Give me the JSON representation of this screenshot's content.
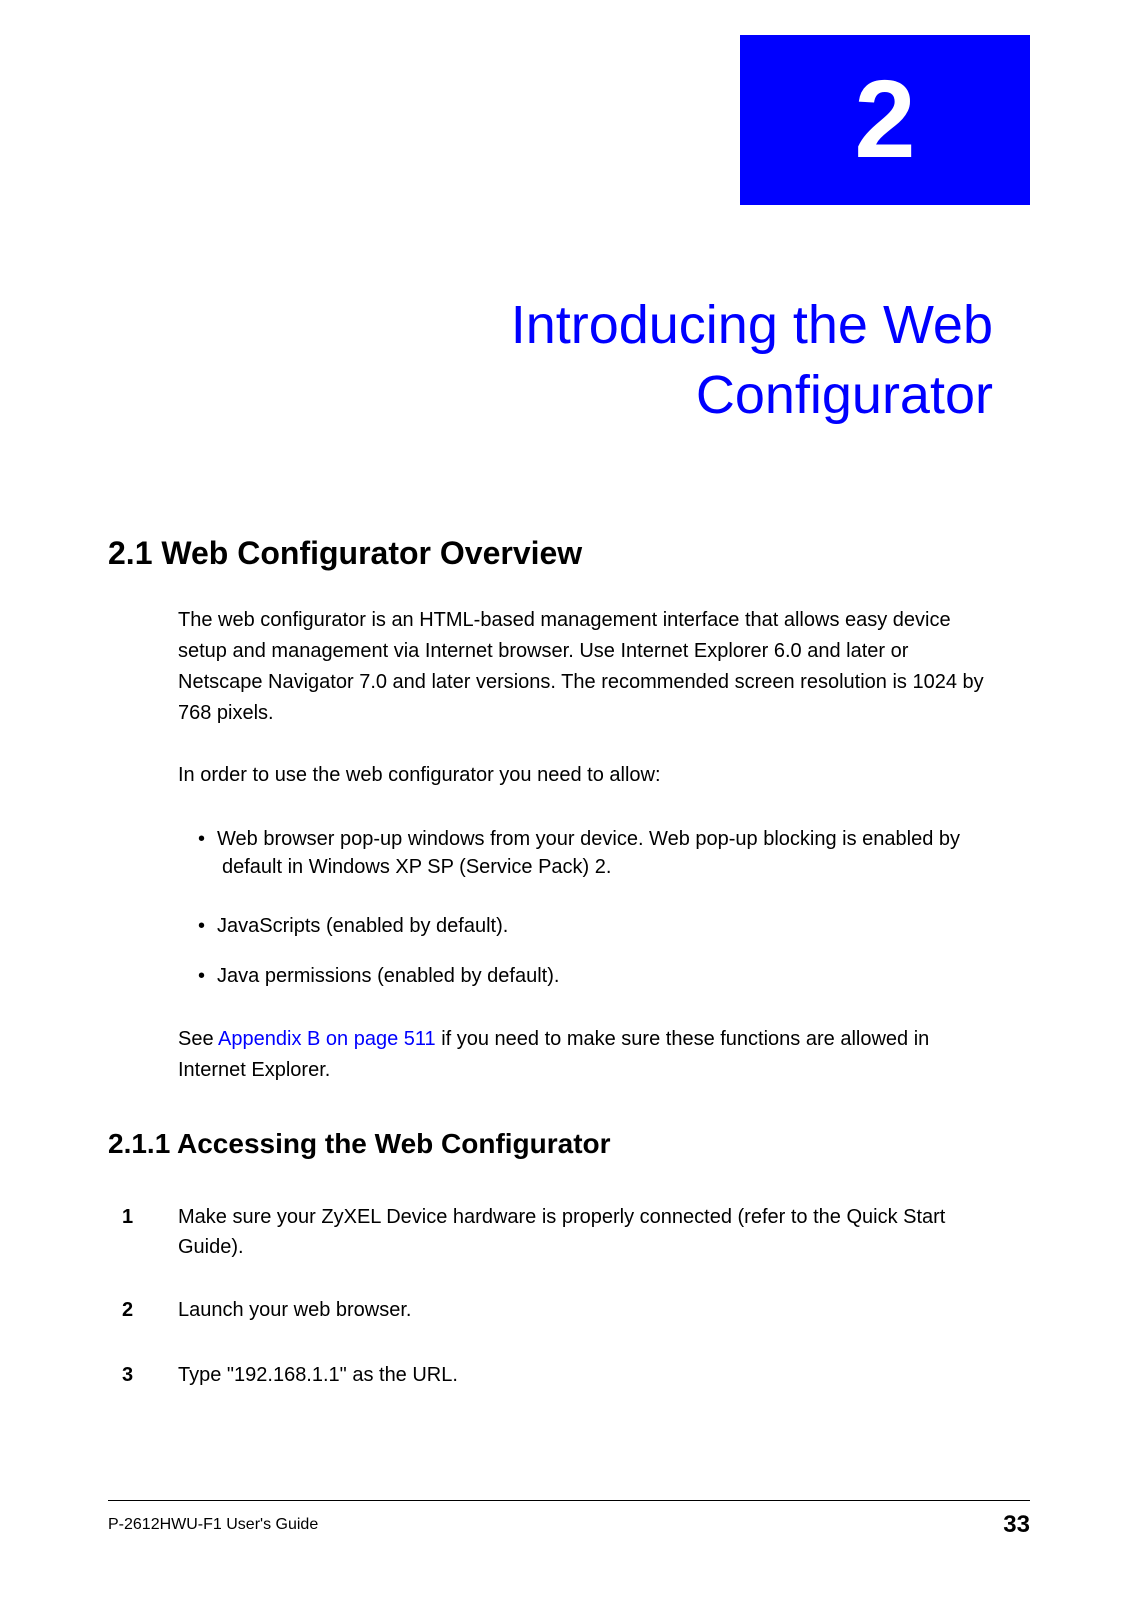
{
  "chapter": {
    "number": "2",
    "title": "Introducing the Web Configurator"
  },
  "section_2_1": {
    "heading": "2.1  Web Configurator Overview",
    "para1": "The web configurator is an HTML-based management interface that allows easy device setup and management via Internet browser. Use Internet Explorer 6.0 and later or Netscape Navigator 7.0 and later versions. The recommended screen resolution is 1024 by 768 pixels.",
    "para2": "In order to use the web configurator you need to allow:",
    "bullets": [
      "Web browser pop-up windows from your device. Web pop-up blocking is enabled by default in Windows XP SP (Service Pack) 2.",
      "JavaScripts (enabled by default).",
      "Java permissions (enabled by default)."
    ],
    "see_prefix": "See ",
    "see_link": "Appendix B on page 511",
    "see_suffix": " if you need to make sure these functions are allowed in Internet Explorer."
  },
  "section_2_1_1": {
    "heading": "2.1.1  Accessing the Web Configurator",
    "steps": [
      {
        "num": "1",
        "text": "Make sure your ZyXEL Device hardware is properly connected (refer to the Quick Start Guide)."
      },
      {
        "num": "2",
        "text": "Launch your web browser."
      },
      {
        "num": "3",
        "text": "Type \"192.168.1.1\" as the URL."
      }
    ]
  },
  "footer": {
    "left": "P-2612HWU-F1 User's Guide",
    "page": "33"
  }
}
